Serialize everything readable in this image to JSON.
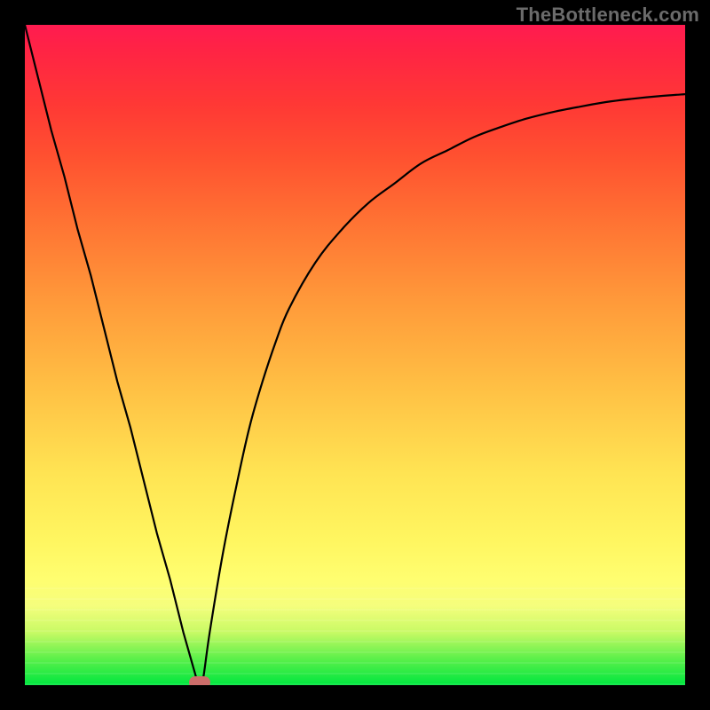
{
  "watermark": "TheBottleneck.com",
  "colors": {
    "frame": "#000000",
    "marker": "#cc6d6a",
    "curve": "#000000"
  },
  "chart_data": {
    "type": "line",
    "title": "",
    "xlabel": "",
    "ylabel": "",
    "xlim": [
      0,
      100
    ],
    "ylim": [
      0,
      100
    ],
    "x": [
      0,
      2,
      4,
      6,
      8,
      10,
      12,
      14,
      16,
      18,
      20,
      22,
      24,
      26,
      26.5,
      27,
      28,
      30,
      32,
      34,
      36,
      38,
      40,
      44,
      48,
      52,
      56,
      60,
      64,
      68,
      72,
      76,
      80,
      84,
      88,
      92,
      96,
      100
    ],
    "values": [
      100,
      92,
      84,
      77,
      69,
      62,
      54,
      46,
      39,
      31,
      23,
      16,
      8,
      1,
      0,
      1,
      8,
      20,
      30,
      39,
      46,
      52,
      57,
      64,
      69,
      73,
      76,
      79,
      81,
      83,
      84.5,
      85.8,
      86.8,
      87.6,
      88.3,
      88.8,
      89.2,
      89.5
    ],
    "marker": {
      "x": 26.5,
      "y": 0
    },
    "background_gradient": {
      "direction": "bottom-to-top",
      "stops": [
        "#00e63f",
        "#fffe70",
        "#ff1b50"
      ]
    }
  }
}
